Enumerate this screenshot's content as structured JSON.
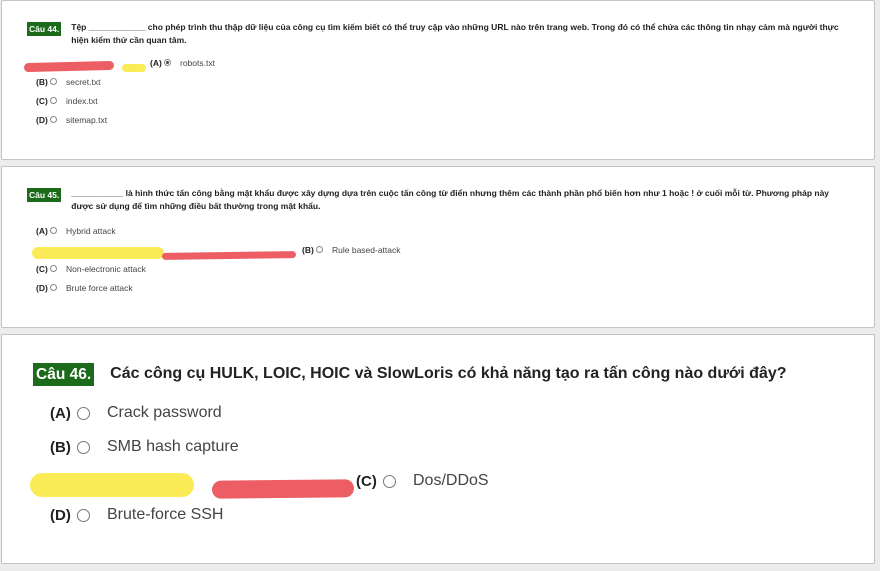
{
  "q44": {
    "badge": "Câu 44.",
    "question": "Tệp ____________ cho phép trình thu thập dữ liệu của công cụ tìm kiếm biết có thể truy cập vào những URL nào trên trang web. Trong đó có thể chứa các thông tin nhạy cảm mà người thực hiện kiểm thử cần quan tâm.",
    "options": [
      {
        "letter": "(A)",
        "text": "robots.txt",
        "selected": true
      },
      {
        "letter": "(B)",
        "text": "secret.txt",
        "selected": false
      },
      {
        "letter": "(C)",
        "text": "index.txt",
        "selected": false
      },
      {
        "letter": "(D)",
        "text": "sitemap.txt",
        "selected": false
      }
    ]
  },
  "q45": {
    "badge": "Câu 45.",
    "question": "___________ là hình thức tấn công bằng mật khẩu được xây dựng dựa trên cuộc tấn công từ điển nhưng thêm các thành phần phổ biến hơn như 1 hoặc ! ở cuối mỗi từ. Phương pháp này được sử dụng để tìm những điều bất thường trong mật khẩu.",
    "options": [
      {
        "letter": "(A)",
        "text": "Hybrid attack",
        "selected": false
      },
      {
        "letter": "(B)",
        "text": "Rule based-attack",
        "selected": false
      },
      {
        "letter": "(C)",
        "text": "Non-electronic attack",
        "selected": false
      },
      {
        "letter": "(D)",
        "text": "Brute force attack",
        "selected": false
      }
    ]
  },
  "q46": {
    "badge": "Câu 46.",
    "question": "Các công cụ HULK, LOIC, HOIC và SlowLoris có khả năng tạo ra tấn công nào dưới đây?",
    "options": [
      {
        "letter": "(A)",
        "text": "Crack password",
        "selected": false
      },
      {
        "letter": "(B)",
        "text": "SMB hash capture",
        "selected": false
      },
      {
        "letter": "(C)",
        "text": "Dos/DDoS",
        "selected": false
      },
      {
        "letter": "(D)",
        "text": "Brute-force SSH",
        "selected": false
      }
    ]
  },
  "highlight_colors": {
    "red": "#e51e28",
    "yellow": "#fae628"
  }
}
